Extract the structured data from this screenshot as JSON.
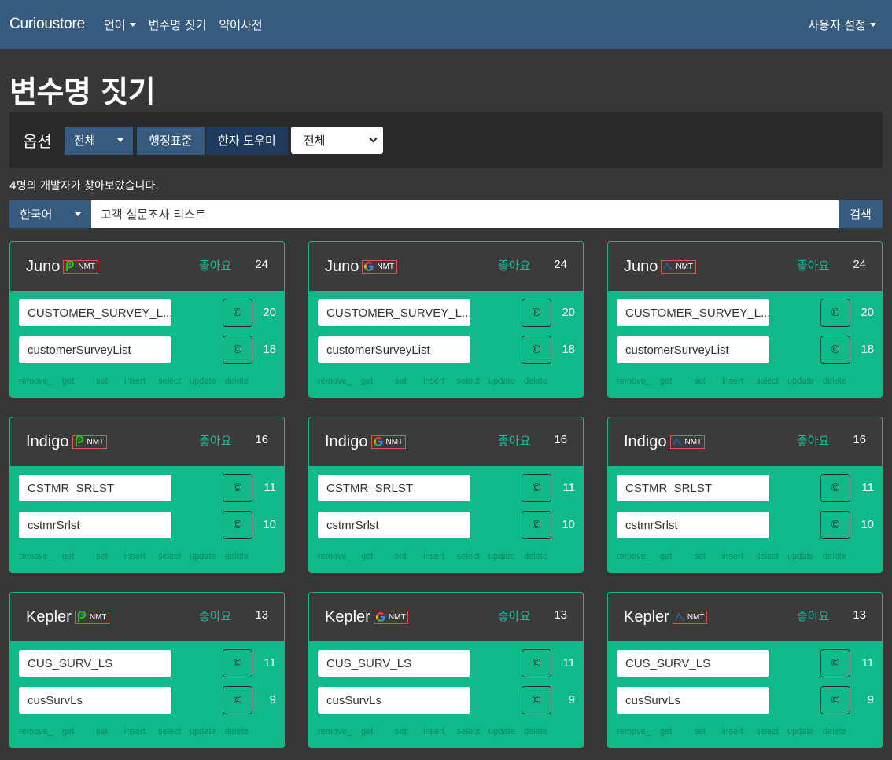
{
  "nav": {
    "brand": "Curioustore",
    "items": [
      "언어",
      "변수명 짓기",
      "약어사전"
    ],
    "user_menu": "사용자 설정"
  },
  "page_title": "변수명 짓기",
  "options": {
    "label": "옵션",
    "scope_selected": "전체",
    "standard_label": "행정표준",
    "hanja_label": "한자 도우미",
    "select_value": "전체"
  },
  "visit_text": "4명의 개발자가 찾아보았습니다.",
  "search": {
    "language": "한국어",
    "query": "고객 설문조사 리스트",
    "button": "검색"
  },
  "like_label": "좋아요",
  "action_labels": [
    "remove_",
    "get",
    "set",
    "insert",
    "select",
    "update",
    "delete"
  ],
  "engines": [
    {
      "name": "papago",
      "badge": "NMT",
      "logo": "papago-icon"
    },
    {
      "name": "google",
      "badge": "NMT",
      "logo": "google-icon"
    },
    {
      "name": "kakao",
      "badge": "NMT",
      "logo": "kakao-icon"
    }
  ],
  "colors": {
    "navbar": "#375a7f",
    "card_body": "#0fb98a",
    "like": "#18bc9c",
    "badge_border": "#d9534f"
  },
  "rows": [
    {
      "name": "Juno",
      "likes": "24",
      "results": [
        {
          "value": "CUSTOMER_SURVEY_L...",
          "count": "20"
        },
        {
          "value": "customerSurveyList",
          "count": "18"
        }
      ]
    },
    {
      "name": "Indigo",
      "likes": "16",
      "results": [
        {
          "value": "CSTMR_SRLST",
          "count": "11"
        },
        {
          "value": "cstmrSrlst",
          "count": "10"
        }
      ]
    },
    {
      "name": "Kepler",
      "likes": "13",
      "results": [
        {
          "value": "CUS_SURV_LS",
          "count": "11"
        },
        {
          "value": "cusSurvLs",
          "count": "9"
        }
      ]
    }
  ]
}
